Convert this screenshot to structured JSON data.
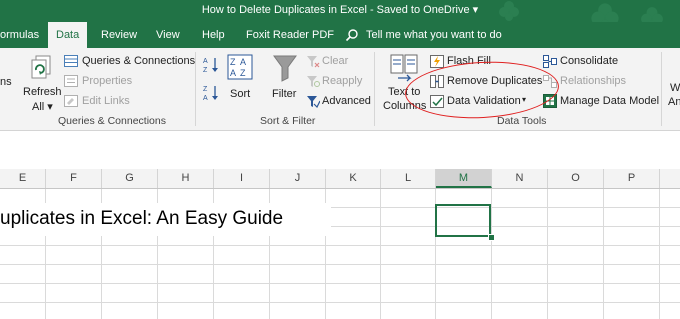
{
  "title_bar": {
    "title": "How to Delete Duplicates in Excel  -  Saved to OneDrive  ▾"
  },
  "tabs": [
    {
      "label": "ormulas"
    },
    {
      "label": "Data"
    },
    {
      "label": "Review"
    },
    {
      "label": "View"
    },
    {
      "label": "Help"
    },
    {
      "label": "Foxit Reader PDF"
    }
  ],
  "tell_me": "Tell me what you want to do",
  "ribbon": {
    "left_cut": "ns",
    "refresh": {
      "line1": "Refresh",
      "line2": "All ▾"
    },
    "queries_connections": "Queries & Connections",
    "properties": "Properties",
    "edit_links": "Edit Links",
    "sort": "Sort",
    "filter": "Filter",
    "clear": "Clear",
    "reapply": "Reapply",
    "advanced": "Advanced",
    "text_to_columns": {
      "line1": "Text to",
      "line2": "Columns"
    },
    "flash_fill": "Flash Fill",
    "remove_duplicates": "Remove Duplicates",
    "data_validation": "Data Validation",
    "data_validation_arrow": "▾",
    "consolidate": "Consolidate",
    "relationships": "Relationships",
    "manage_data_model": "Manage Data Model",
    "right_cut": {
      "line1": "W",
      "line2": "An"
    },
    "groups": {
      "queries": "Queries & Connections",
      "sort_filter": "Sort & Filter",
      "data_tools": "Data Tools"
    }
  },
  "columns": [
    "E",
    "F",
    "G",
    "H",
    "I",
    "J",
    "K",
    "L",
    "M",
    "N",
    "O",
    "P"
  ],
  "selected_column": "M",
  "cell_text": "uplicates in Excel: An Easy Guide",
  "colors": {
    "excel_green": "#217346",
    "annotation_red": "#e02020"
  }
}
